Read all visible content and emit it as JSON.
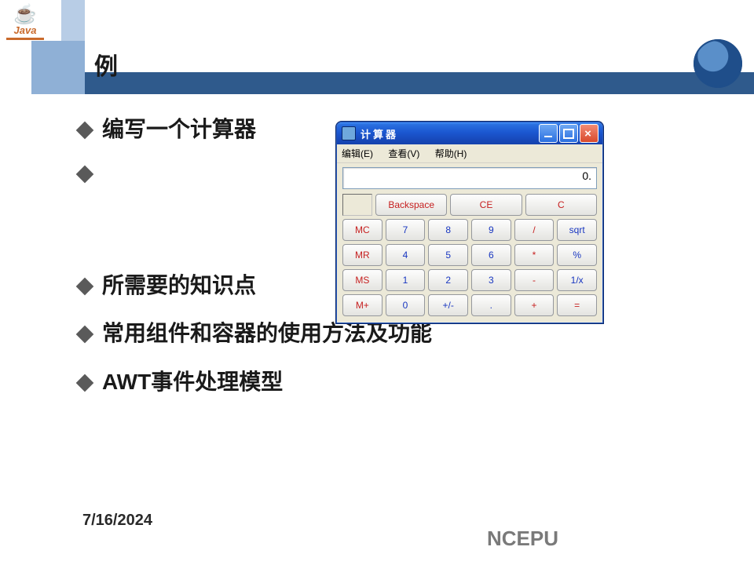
{
  "logo": {
    "java": "Java"
  },
  "title": "例",
  "bullets": [
    "编写一个计算器",
    "",
    "所需要的知识点",
    "常用组件和容器的使用方法及功能",
    "AWT事件处理模型"
  ],
  "footer": {
    "date": "7/16/2024",
    "org": "NCEPU"
  },
  "calc": {
    "title": "计算器",
    "menu": {
      "edit": "编辑(E)",
      "view": "查看(V)",
      "help": "帮助(H)"
    },
    "display": "0.",
    "clearRow": [
      "Backspace",
      "CE",
      "C"
    ],
    "grid": [
      [
        "MC",
        "7",
        "8",
        "9",
        "/",
        "sqrt"
      ],
      [
        "MR",
        "4",
        "5",
        "6",
        "*",
        "%"
      ],
      [
        "MS",
        "1",
        "2",
        "3",
        "-",
        "1/x"
      ],
      [
        "M+",
        "0",
        "+/-",
        ".",
        "+",
        "="
      ]
    ]
  }
}
